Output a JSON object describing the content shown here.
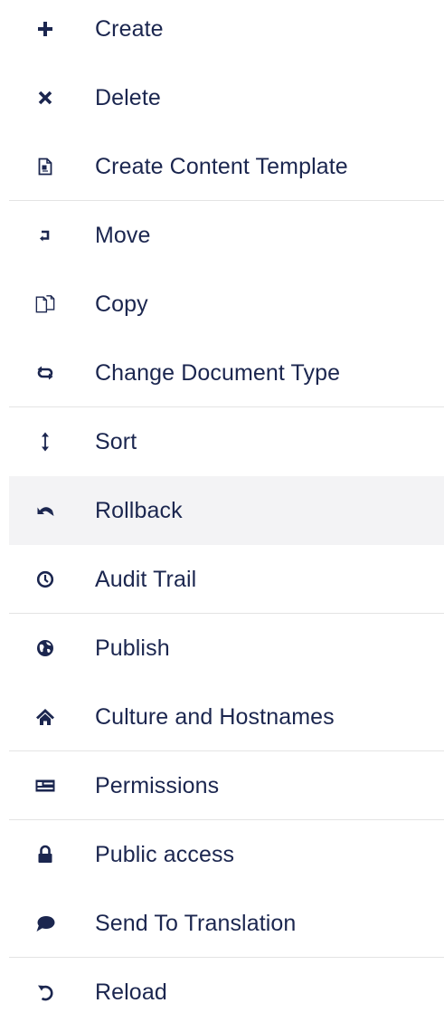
{
  "menu": {
    "items": [
      {
        "label": "Create",
        "icon": "plus-icon"
      },
      {
        "label": "Delete",
        "icon": "delete-x-icon"
      },
      {
        "label": "Create Content Template",
        "icon": "blueprint-icon"
      },
      {
        "label": "Move",
        "icon": "move-icon"
      },
      {
        "label": "Copy",
        "icon": "copy-documents-icon"
      },
      {
        "label": "Change Document Type",
        "icon": "change-type-arrows-icon"
      },
      {
        "label": "Sort",
        "icon": "sort-vertical-arrows-icon"
      },
      {
        "label": "Rollback",
        "icon": "rollback-arrow-icon"
      },
      {
        "label": "Audit Trail",
        "icon": "clock-icon"
      },
      {
        "label": "Publish",
        "icon": "globe-icon"
      },
      {
        "label": "Culture and Hostnames",
        "icon": "home-icon"
      },
      {
        "label": "Permissions",
        "icon": "id-card-icon"
      },
      {
        "label": "Public access",
        "icon": "lock-icon"
      },
      {
        "label": "Send To Translation",
        "icon": "speech-bubble-icon"
      },
      {
        "label": "Reload",
        "icon": "reload-arrow-icon"
      }
    ],
    "active_item": "Rollback"
  },
  "colors": {
    "text": "#1b264f",
    "icon": "#1b264f",
    "divider": "#e4e4e4",
    "active_background": "#f3f3f5"
  }
}
